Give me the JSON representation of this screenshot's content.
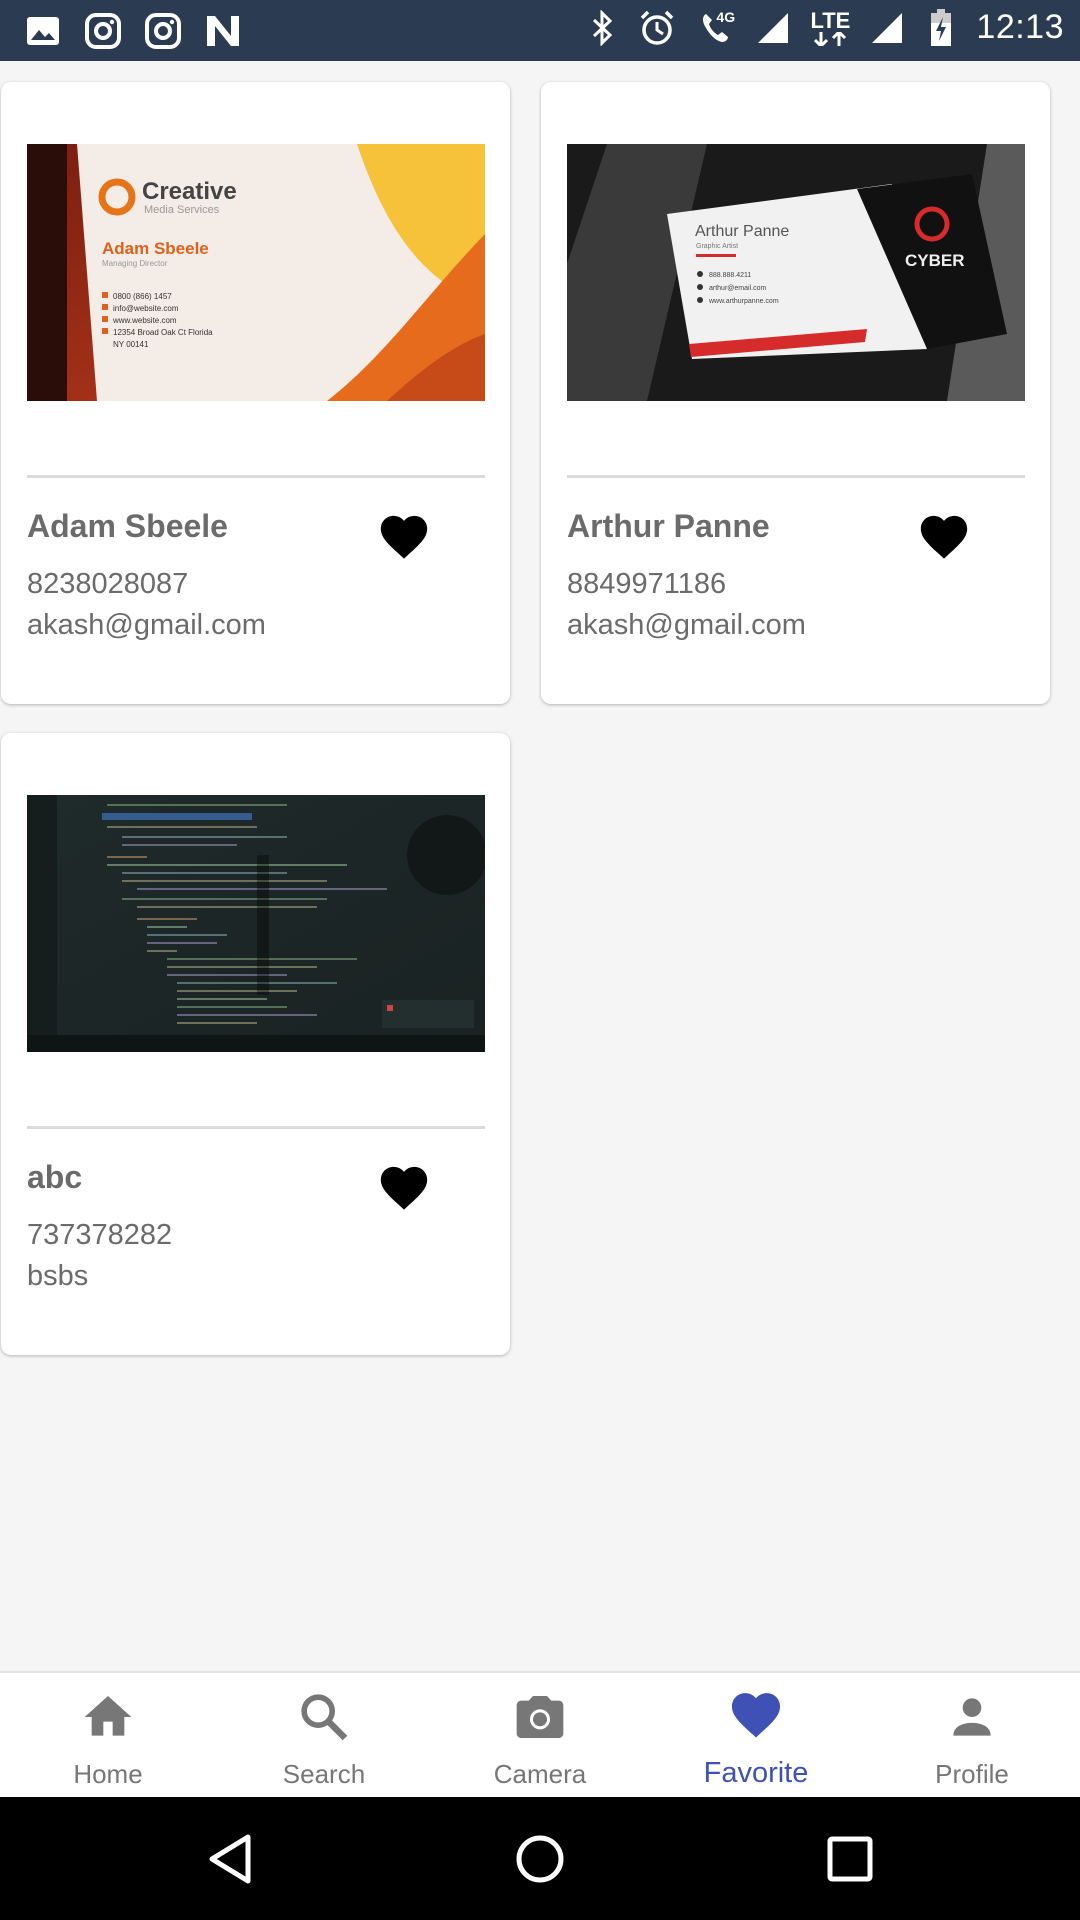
{
  "status_bar": {
    "time": "12:13",
    "network_label": "LTE",
    "call_label": "4G",
    "left_icons": [
      "image-icon",
      "instagram-icon",
      "instagram-icon",
      "n-app-icon"
    ],
    "right_icons": [
      "bluetooth-icon",
      "alarm-icon",
      "call-4g-icon",
      "signal-icon",
      "lte-icon",
      "signal-icon",
      "battery-charging-icon"
    ]
  },
  "cards": [
    {
      "name": "Adam Sbeele",
      "phone": "8238028087",
      "email": "akash@gmail.com",
      "favorite": true,
      "photo": {
        "brand": "Creative",
        "brand_sub": "Media Services",
        "person": "Adam Sbeele",
        "role": "Managing Director",
        "lines": [
          "0800 (866) 1457",
          "info@website.com",
          "www.website.com",
          "12354 Broad Oak Ct Florida",
          "NY 00141"
        ]
      }
    },
    {
      "name": "Arthur Panne",
      "phone": "8849971186",
      "email": "akash@gmail.com",
      "favorite": true,
      "photo": {
        "person": "Arthur Panne",
        "role": "Graphic Artist",
        "brand": "CYBER",
        "lines": [
          "888.888.4211",
          "arthur@email.com",
          "www.arthurpanne.com"
        ]
      }
    },
    {
      "name": "abc",
      "phone": "737378282",
      "email": "bsbs",
      "favorite": true,
      "photo": {
        "description_icon": "code-screen-photo"
      }
    }
  ],
  "bottom_nav": [
    {
      "label": "Home",
      "icon": "home-icon",
      "active": false
    },
    {
      "label": "Search",
      "icon": "search-icon",
      "active": false
    },
    {
      "label": "Camera",
      "icon": "camera-icon",
      "active": false
    },
    {
      "label": "Favorite",
      "icon": "heart-icon",
      "active": true
    },
    {
      "label": "Profile",
      "icon": "person-icon",
      "active": false
    }
  ],
  "colors": {
    "status_bar": "#2b3b52",
    "active_nav": "#3f51b5",
    "inactive_nav": "#777777",
    "card_text": "#6b6b6b",
    "heart": "#000000"
  }
}
